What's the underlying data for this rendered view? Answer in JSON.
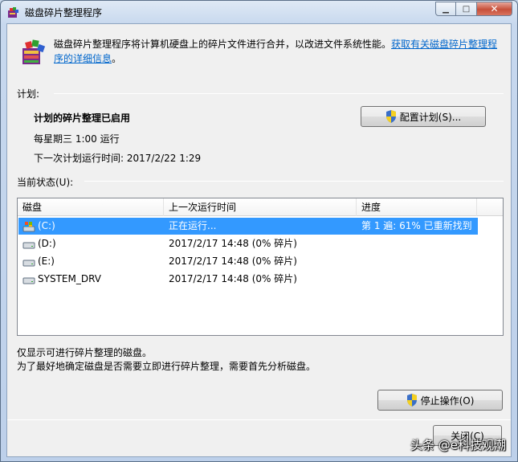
{
  "window": {
    "title": "磁盘碎片整理程序",
    "minimize_glyph": "▁",
    "maximize_glyph": "□",
    "close_glyph": "✕"
  },
  "header": {
    "description": "磁盘碎片整理程序将计算机硬盘上的碎片文件进行合并，以改进文件系统性能。",
    "link_text": "获取有关磁盘碎片整理程序的详细信息",
    "link_suffix": "。"
  },
  "schedule": {
    "section_label": "计划:",
    "status": "计划的碎片整理已启用",
    "frequency": "每星期三  1:00 运行",
    "next_run": "下一次计划运行时间: 2017/2/22 1:29",
    "configure_button": "配置计划(S)..."
  },
  "current_status": {
    "section_label": "当前状态(U):",
    "columns": [
      "磁盘",
      "上一次运行时间",
      "进度"
    ],
    "rows": [
      {
        "disk": "(C:)",
        "last_run": "正在运行...",
        "progress": "第 1 遍: 61% 已重新找到",
        "icon": "system-drive-icon",
        "selected": true
      },
      {
        "disk": "(D:)",
        "last_run": "2017/2/17 14:48 (0% 碎片)",
        "progress": "",
        "icon": "drive-icon",
        "selected": false
      },
      {
        "disk": "(E:)",
        "last_run": "2017/2/17 14:48 (0% 碎片)",
        "progress": "",
        "icon": "drive-icon",
        "selected": false
      },
      {
        "disk": "SYSTEM_DRV",
        "last_run": "2017/2/17 14:48 (0% 碎片)",
        "progress": "",
        "icon": "drive-icon",
        "selected": false
      }
    ]
  },
  "footer": {
    "note1": "仅显示可进行碎片整理的磁盘。",
    "note2": "为了最好地确定磁盘是否需要立即进行碎片整理，需要首先分析磁盘。",
    "stop_button": "停止操作(O)",
    "close_button": "关闭(C)"
  },
  "watermark": "头条 @e科技观潮",
  "colors": {
    "selection": "#3399ff",
    "link": "#0066cc"
  }
}
